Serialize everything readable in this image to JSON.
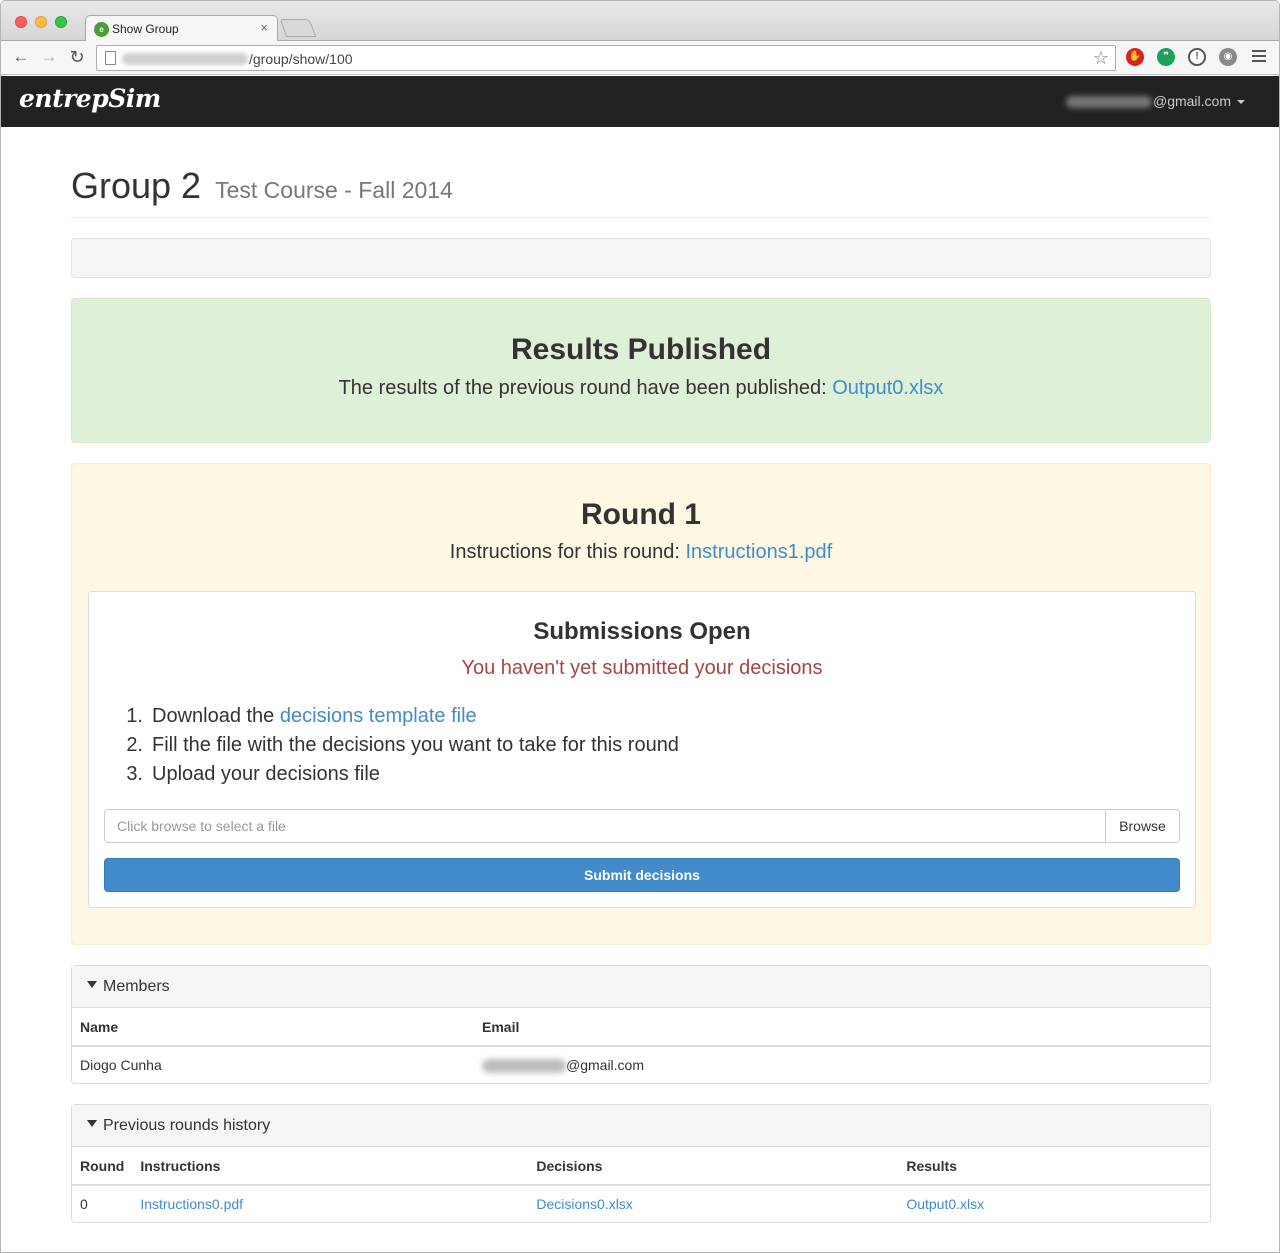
{
  "browser": {
    "tab_title": "Show Group",
    "tab_close": "×",
    "url_path": "/group/show/100",
    "back": "←",
    "forward": "→",
    "reload": "↻",
    "star": "☆"
  },
  "navbar": {
    "brand": "entrepSim",
    "user_email_suffix": "@gmail.com"
  },
  "page": {
    "title": "Group 2",
    "subtitle": "Test Course - Fall 2014"
  },
  "results_alert": {
    "heading": "Results Published",
    "text": "The results of the previous round have been published:",
    "link": "Output0.xlsx"
  },
  "round": {
    "heading": "Round 1",
    "instructions_label": "Instructions for this round:",
    "instructions_link": "Instructions1.pdf",
    "submissions": {
      "heading": "Submissions Open",
      "status": "You haven't yet submitted your decisions",
      "steps": [
        {
          "num": "1.",
          "prefix": "Download the",
          "link": "decisions template file"
        },
        {
          "num": "2.",
          "text": "Fill the file with the decisions you want to take for this round"
        },
        {
          "num": "3.",
          "text": "Upload your decisions file"
        }
      ],
      "file_placeholder": "Click browse to select a file",
      "browse_label": "Browse",
      "submit_label": "Submit decisions"
    }
  },
  "members": {
    "heading": "Members",
    "columns": [
      "Name",
      "Email"
    ],
    "rows": [
      {
        "name": "Diogo Cunha",
        "email_suffix": "@gmail.com"
      }
    ]
  },
  "history": {
    "heading": "Previous rounds history",
    "columns": [
      "Round",
      "Instructions",
      "Decisions",
      "Results"
    ],
    "rows": [
      {
        "round": "0",
        "instructions": "Instructions0.pdf",
        "decisions": "Decisions0.xlsx",
        "results": "Output0.xlsx"
      }
    ]
  },
  "colors": {
    "link": "#428bca",
    "success_bg": "#dff0d8",
    "warning_bg": "#fcf8e3",
    "danger_text": "#a94442",
    "navbar_bg": "#222222",
    "primary_button": "#428bca"
  }
}
